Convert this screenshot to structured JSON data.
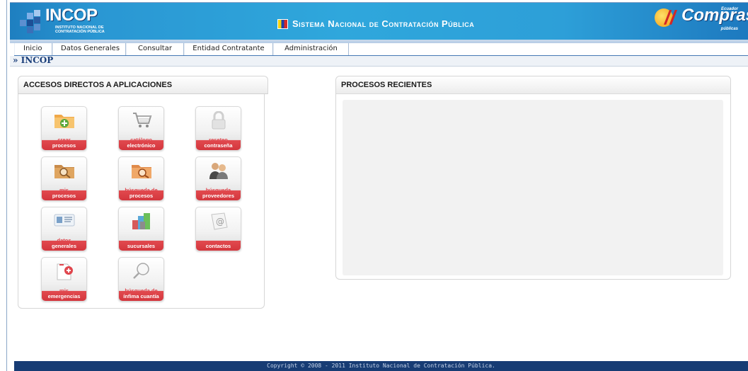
{
  "header": {
    "logo_title": "INCOP",
    "logo_subtitle_1": "INSTITUTO NACIONAL DE",
    "logo_subtitle_2": "CONTRATACIÓN PÚBLICA",
    "system_title": "Sistema Nacional de Contratación Pública",
    "brand": {
      "slash": "//",
      "name": "Compras",
      "top": "Ecuador",
      "bottom": "públicas"
    },
    "colors": {
      "accent": "#2fa7dc",
      "dark": "#173c74",
      "tile_red": "#d4363d"
    }
  },
  "menu": {
    "items": [
      "Inicio",
      "Datos Generales",
      "Consultar",
      "Entidad Contratante",
      "Administración"
    ]
  },
  "breadcrumb": {
    "text": "» INCOP"
  },
  "accesos": {
    "title": "ACCESOS DIRECTOS A APLICACIONES",
    "tiles": [
      {
        "l1": "crear",
        "l2": "procesos",
        "icon": "folder-add-icon"
      },
      {
        "l1": "catálogo",
        "l2": "electrónico",
        "icon": "cart-icon"
      },
      {
        "l1": "reseteo",
        "l2": "contraseña",
        "icon": "lock-icon"
      },
      {
        "l1": "mis",
        "l2": "procesos",
        "icon": "folder-search-icon"
      },
      {
        "l1": "búsqueda de",
        "l2": "procesos",
        "icon": "folder-magnify-icon"
      },
      {
        "l1": "búsqueda",
        "l2": "proveedores",
        "icon": "people-icon"
      },
      {
        "l1": "datos",
        "l2": "generales",
        "icon": "id-card-icon"
      },
      {
        "l1": "",
        "l2": "sucursales",
        "icon": "buildings-icon"
      },
      {
        "l1": "",
        "l2": "contactos",
        "icon": "at-sign-icon"
      },
      {
        "l1": "mis",
        "l2": "emergencias",
        "icon": "first-aid-icon"
      },
      {
        "l1": "búsqueda de",
        "l2": "ínfima cuantía",
        "icon": "magnifier-icon"
      }
    ]
  },
  "recientes": {
    "title": "PROCESOS RECIENTES"
  },
  "footer": {
    "copyright": "Copyright © 2008 - 2011 Instituto Nacional de Contratación Pública."
  }
}
